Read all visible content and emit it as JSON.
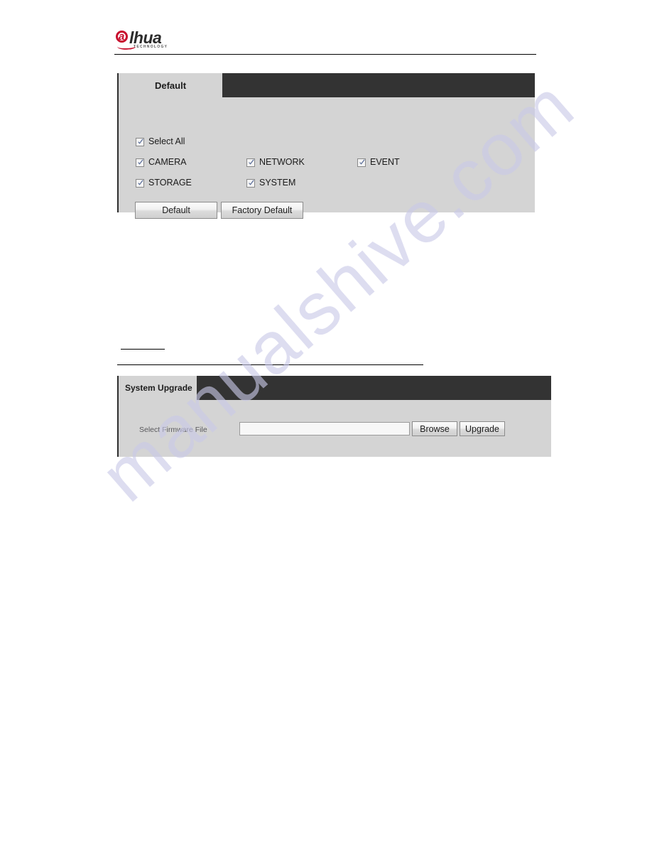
{
  "header": {
    "logo_mark": "a",
    "logo_word": "lhua",
    "logo_sub": "TECHNOLOGY"
  },
  "watermark": {
    "text": "manualshive.com"
  },
  "panels": {
    "default": {
      "tab_label": "Default",
      "select_all": {
        "label": "Select All",
        "checked": true
      },
      "options": [
        {
          "label": "CAMERA",
          "checked": true
        },
        {
          "label": "NETWORK",
          "checked": true
        },
        {
          "label": "EVENT",
          "checked": true
        },
        {
          "label": "STORAGE",
          "checked": true
        },
        {
          "label": "SYSTEM",
          "checked": true
        }
      ],
      "buttons": {
        "default": "Default",
        "factory_default": "Factory Default"
      }
    },
    "upgrade": {
      "tab_label": "System Upgrade",
      "field_label": "Select Firmware File",
      "file_value": "",
      "file_placeholder": "",
      "buttons": {
        "browse": "Browse",
        "upgrade": "Upgrade"
      }
    }
  },
  "colors": {
    "panel_bg": "#d4d4d4",
    "tabbar_bg": "#333333",
    "brand_red": "#c8102e",
    "watermark": "#c9c9e8"
  }
}
